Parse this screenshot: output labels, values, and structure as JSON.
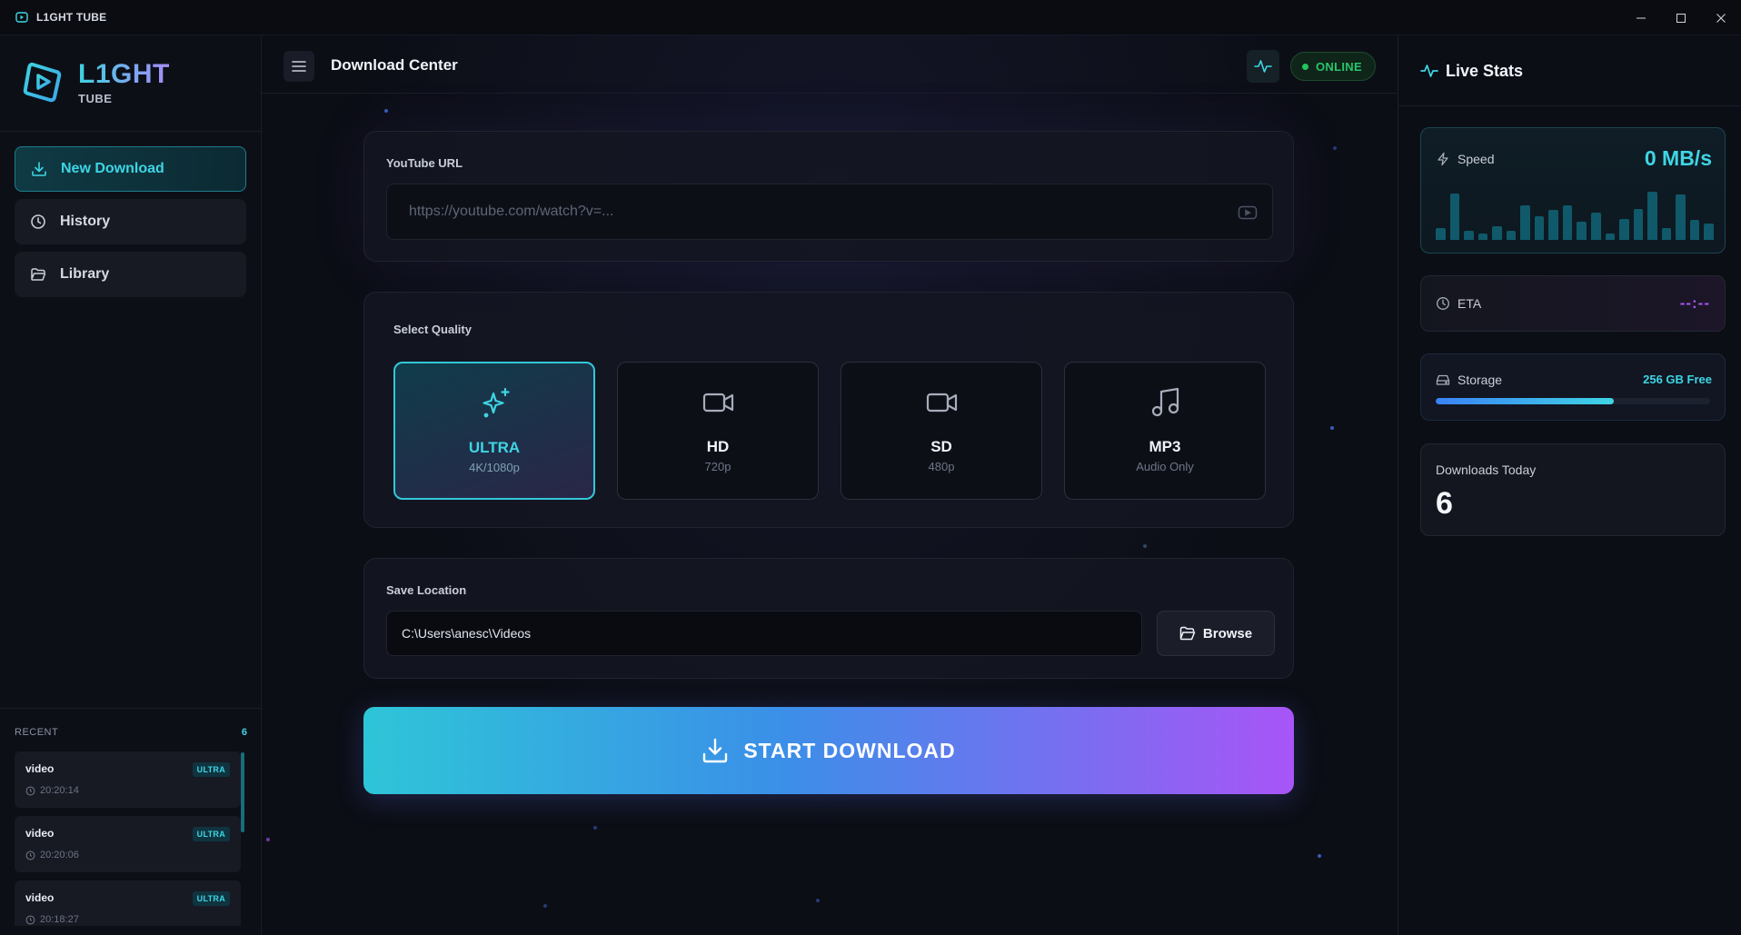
{
  "window": {
    "title": "L1GHT TUBE",
    "controls": [
      "minimize",
      "maximize",
      "close"
    ]
  },
  "sidebar": {
    "logo_main": "L1GHT",
    "logo_sub": "TUBE",
    "nav": [
      {
        "label": "New Download",
        "icon": "download-icon",
        "active": true
      },
      {
        "label": "History",
        "icon": "clock-icon",
        "active": false
      },
      {
        "label": "Library",
        "icon": "folder-icon",
        "active": false
      }
    ],
    "recent": {
      "label": "RECENT",
      "count": "6",
      "items": [
        {
          "name": "video",
          "badge": "ULTRA",
          "time": "20:20:14"
        },
        {
          "name": "video",
          "badge": "ULTRA",
          "time": "20:20:06"
        },
        {
          "name": "video",
          "badge": "ULTRA",
          "time": "20:18:27"
        }
      ]
    }
  },
  "header": {
    "title": "Download Center",
    "status": "ONLINE"
  },
  "url_card": {
    "label": "YouTube URL",
    "placeholder": "https://youtube.com/watch?v=..."
  },
  "quality": {
    "label": "Select Quality",
    "options": [
      {
        "name": "ULTRA",
        "sub": "4K/1080p",
        "icon": "sparkles-icon",
        "selected": true
      },
      {
        "name": "HD",
        "sub": "720p",
        "icon": "video-camera-icon",
        "selected": false
      },
      {
        "name": "SD",
        "sub": "480p",
        "icon": "video-camera-icon",
        "selected": false
      },
      {
        "name": "MP3",
        "sub": "Audio Only",
        "icon": "music-note-icon",
        "selected": false
      }
    ]
  },
  "save": {
    "label": "Save Location",
    "path": "C:\\Users\\anesc\\Videos",
    "browse_label": "Browse"
  },
  "start_button": "START DOWNLOAD",
  "live_stats": {
    "title": "Live Stats",
    "speed_label": "Speed",
    "speed_value": "0 MB/s",
    "speed_history": [
      0.2,
      0.78,
      0.15,
      0.1,
      0.22,
      0.15,
      0.58,
      0.4,
      0.5,
      0.58,
      0.3,
      0.45,
      0.1,
      0.35,
      0.52,
      0.8,
      0.2,
      0.75,
      0.33,
      0.28
    ],
    "eta_label": "ETA",
    "eta_value": "--:--",
    "storage_label": "Storage",
    "storage_value": "256 GB Free",
    "storage_fill": 0.65,
    "downloads_label": "Downloads Today",
    "downloads_value": "6"
  },
  "colors": {
    "accent_cyan": "#3fd5e4",
    "accent_purple": "#a855f7",
    "online_green": "#22c55e"
  }
}
